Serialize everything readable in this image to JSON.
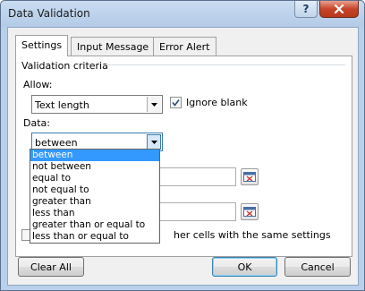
{
  "window": {
    "title": "Data Validation",
    "help_label": "?",
    "close_icon": "close-icon"
  },
  "tabs": [
    {
      "label": "Settings",
      "active": true
    },
    {
      "label": "Input Message",
      "active": false
    },
    {
      "label": "Error Alert",
      "active": false
    }
  ],
  "settings": {
    "section_label": "Validation criteria",
    "allow_label": "Allow:",
    "allow_value": "Text length",
    "ignore_blank_label": "Ignore blank",
    "ignore_blank_checked": true,
    "data_label": "Data:",
    "data_value": "between",
    "data_options": [
      "between",
      "not between",
      "equal to",
      "not equal to",
      "greater than",
      "less than",
      "greater than or equal to",
      "less than or equal to"
    ],
    "data_selected_index": 0,
    "apply_all_partial": "her cells with the same settings"
  },
  "buttons": {
    "clear_all": "Clear All",
    "ok": "OK",
    "cancel": "Cancel"
  },
  "colors": {
    "selection": "#3399ff",
    "title_bar": "#b8d0ea",
    "close_button": "#c6452a"
  }
}
